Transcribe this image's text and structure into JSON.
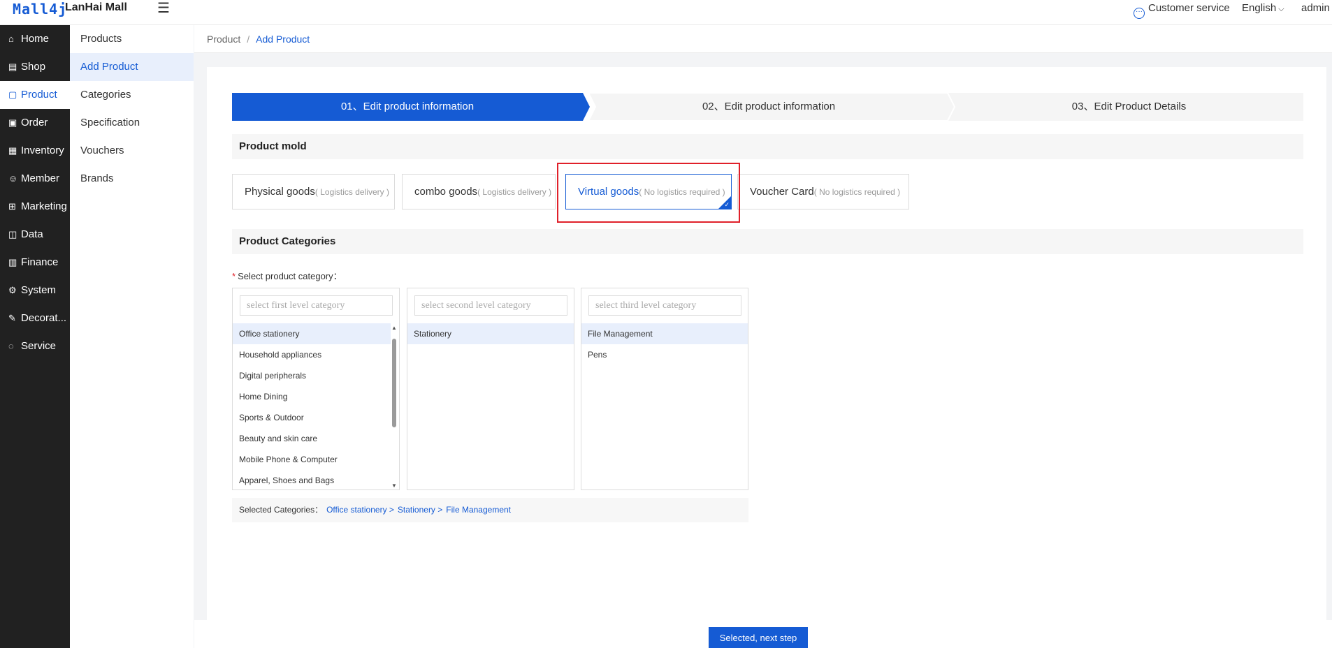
{
  "header": {
    "logo": "Mall4j",
    "mall_name": "LanHai Mall",
    "customer_service": "Customer service",
    "language": "English",
    "user": "admin"
  },
  "sidebar": {
    "items": [
      {
        "label": "Home",
        "icon": "home-icon"
      },
      {
        "label": "Shop",
        "icon": "shop-icon"
      },
      {
        "label": "Product",
        "icon": "product-icon"
      },
      {
        "label": "Order",
        "icon": "order-icon"
      },
      {
        "label": "Inventory",
        "icon": "inventory-icon"
      },
      {
        "label": "Member",
        "icon": "member-icon"
      },
      {
        "label": "Marketing",
        "icon": "marketing-icon"
      },
      {
        "label": "Data",
        "icon": "data-icon"
      },
      {
        "label": "Finance",
        "icon": "finance-icon"
      },
      {
        "label": "System",
        "icon": "system-icon"
      },
      {
        "label": "Decorat...",
        "icon": "decorate-icon"
      },
      {
        "label": "Service",
        "icon": "service-icon"
      }
    ],
    "active": "Product"
  },
  "subnav": {
    "items": [
      "Products",
      "Add Product",
      "Categories",
      "Specification",
      "Vouchers",
      "Brands"
    ],
    "active": "Add Product"
  },
  "breadcrumb": {
    "root": "Product",
    "separator": "/",
    "current": "Add Product"
  },
  "steps": [
    {
      "label": "01、Edit product information",
      "active": true
    },
    {
      "label": "02、Edit product information",
      "active": false
    },
    {
      "label": "03、Edit Product Details",
      "active": false
    }
  ],
  "product_mold": {
    "title": "Product mold",
    "options": [
      {
        "name": "Physical goods",
        "note": "( Logistics delivery )"
      },
      {
        "name": "combo goods",
        "note": "( Logistics delivery )"
      },
      {
        "name": "Virtual goods",
        "note": "( No logistics required )"
      },
      {
        "name": "Voucher Card",
        "note": "( No logistics required )"
      }
    ],
    "selected": "Virtual goods"
  },
  "categories": {
    "title": "Product Categories",
    "required_mark": "*",
    "select_label": "Select product category：",
    "first": {
      "placeholder": "select first level category",
      "items": [
        "Office stationery",
        "Household appliances",
        "Digital peripherals",
        "Home Dining",
        "Sports & Outdoor",
        "Beauty and skin care",
        "Mobile Phone & Computer",
        "Apparel, Shoes and Bags"
      ]
    },
    "second": {
      "placeholder": "select second level category",
      "items": [
        "Stationery"
      ]
    },
    "third": {
      "placeholder": "select third level category",
      "items": [
        "File Management",
        "Pens"
      ]
    },
    "selected_label": "Selected Categories：",
    "selected_path": [
      "Office stationery >",
      "Stationery >",
      "File Management"
    ]
  },
  "footer": {
    "next_button": "Selected, next step"
  },
  "colors": {
    "primary": "#155bd4",
    "sidebar_bg": "#212121",
    "highlight_border": "#e0202a"
  }
}
